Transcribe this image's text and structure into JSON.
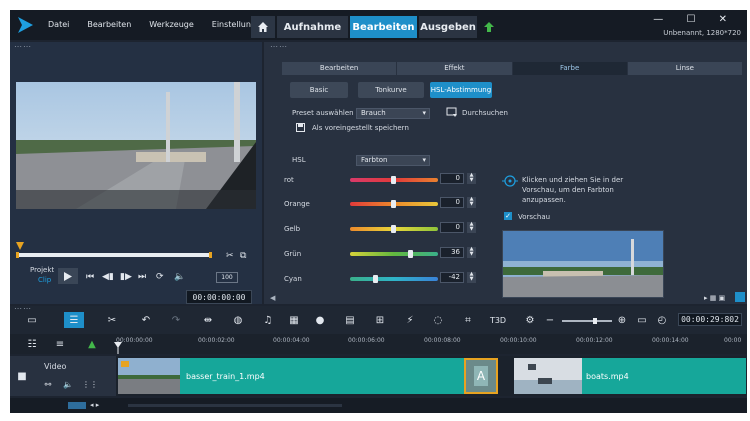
{
  "menu": [
    "Datei",
    "Bearbeiten",
    "Werkzeuge",
    "Einstellungen"
  ],
  "nav_tabs": [
    {
      "label": "Aufnahme",
      "active": false
    },
    {
      "label": "Bearbeiten",
      "active": true
    },
    {
      "label": "Ausgeben",
      "active": false
    }
  ],
  "window_controls": "— ☐ ✕",
  "project_info": "Unbenannt, 1280*720",
  "player": {
    "project_label": "Projekt",
    "clip_label": "Clip",
    "zoom_label": "100",
    "timecode": "00:00:00:00"
  },
  "edit": {
    "subtabs": [
      {
        "label": "Bearbeiten",
        "active": false
      },
      {
        "label": "Effekt",
        "active": false
      },
      {
        "label": "Farbe",
        "active": true
      },
      {
        "label": "Linse",
        "active": false
      }
    ],
    "pills": [
      {
        "label": "Basic",
        "active": false
      },
      {
        "label": "Tonkurve",
        "active": false
      },
      {
        "label": "HSL-Abstimmung",
        "active": true
      }
    ],
    "preset_label": "Preset auswählen",
    "preset_value": "Brauch",
    "browse_label": "Durchsuchen",
    "save_default_label": "Als voreingestellt speichern",
    "hsl_label": "HSL",
    "hsl_value": "Farbton",
    "hint": [
      "Klicken und ziehen Sie in der",
      "Vorschau, um den Farbton",
      "anzupassen."
    ],
    "preview_label": "Vorschau",
    "sliders": [
      {
        "label": "rot",
        "value": "0",
        "position": 0.5
      },
      {
        "label": "Orange",
        "value": "0",
        "position": 0.5
      },
      {
        "label": "Gelb",
        "value": "0",
        "position": 0.5
      },
      {
        "label": "Grün",
        "value": "36",
        "position": 0.68
      },
      {
        "label": "Cyan",
        "value": "-42",
        "position": 0.29
      }
    ]
  },
  "timeline": {
    "timecode": "00:00:29:802",
    "ruler": [
      "00:00:00:00",
      "00:00:02:00",
      "00:00:04:00",
      "00:00:06:00",
      "00:00:08:00",
      "00:00:10:00",
      "00:00:12:00",
      "00:00:14:00",
      "00:00"
    ],
    "track_name": "Video",
    "clips": [
      "basser_train_1.mp4",
      "boats.mp4"
    ]
  },
  "colors": {
    "accent": "#1e8fc9",
    "clip": "#16a79a",
    "transition": "#e7a321"
  }
}
